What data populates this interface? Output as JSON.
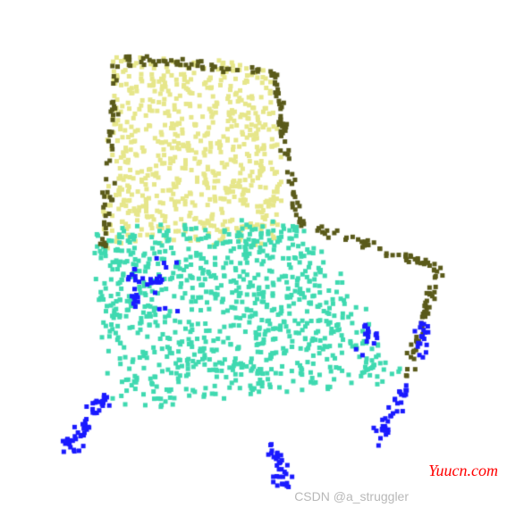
{
  "chart_data": {
    "type": "scatter",
    "title": "",
    "xlabel": "",
    "ylabel": "",
    "xlim": [
      0,
      567
    ],
    "ylim": [
      0,
      578
    ],
    "description": "3D point cloud visualization of a chair, rendered as a 2D projection. Points are colored by semantic segment.",
    "series": [
      {
        "name": "back",
        "color": "#e6e68a",
        "region": "chair back - upper left vertical plane",
        "approximate_count": 700
      },
      {
        "name": "frame",
        "color": "#5a5a1a",
        "region": "chair frame rails - top edge and side rails going right/down",
        "approximate_count": 250
      },
      {
        "name": "seat",
        "color": "#3fd9b0",
        "region": "chair seat - large middle/lower horizontal plane",
        "approximate_count": 900
      },
      {
        "name": "legs",
        "color": "#1a1aff",
        "region": "chair legs - four clusters at bottom corners",
        "approximate_count": 180
      }
    ]
  },
  "watermarks": {
    "site": "Yuucn.com",
    "attribution": "CSDN @a_struggler"
  },
  "colors": {
    "back": "#e6e68a",
    "frame": "#5a5a1a",
    "seat": "#3fd9b0",
    "legs": "#1a1aff"
  }
}
